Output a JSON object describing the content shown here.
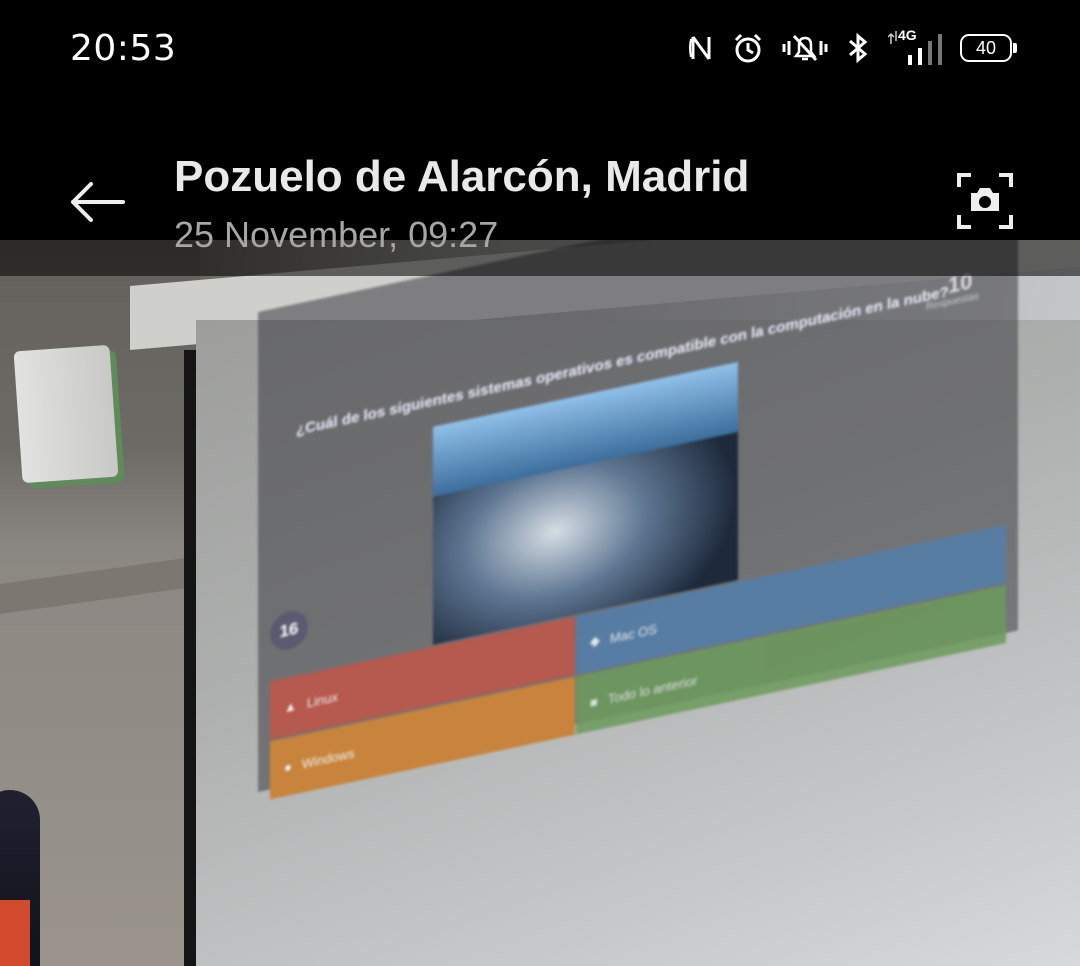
{
  "status_bar": {
    "time": "20:53",
    "network": "4G",
    "battery": "40",
    "icons": [
      "nfc-icon",
      "alarm-icon",
      "silent-icon",
      "bluetooth-icon",
      "signal-icon",
      "battery-icon"
    ]
  },
  "viewer": {
    "title": "Pozuelo de Alarcón, Madrid",
    "subtitle": "25 November, 09:27",
    "back_icon": "back-arrow-icon",
    "action_icon": "camera-lens-icon"
  },
  "photo": {
    "slide": {
      "question": "¿Cuál de los siguientes sistemas operativos es compatible con la computación en la nube?",
      "timer": "16",
      "count": "10",
      "count_label": "Respuestas",
      "answers": [
        "Linux",
        "Mac OS",
        "Windows",
        "Todo lo anterior"
      ],
      "answer_colors": [
        "#b6594f",
        "#557ea8",
        "#c8843c",
        "#6c9a5c"
      ]
    }
  }
}
